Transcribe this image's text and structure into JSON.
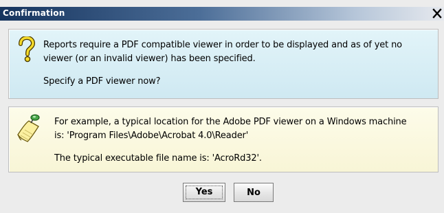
{
  "window": {
    "title": "Confirmation",
    "close_icon": "close-x-icon"
  },
  "info_panel": {
    "icon": "question-mark-icon",
    "line1": "Reports require a PDF compatible viewer in order to be displayed and as of yet no",
    "line2": "viewer (or an invalid viewer) has been specified.",
    "line3": "Specify a PDF viewer now?",
    "background": "#d9eef5"
  },
  "tip_panel": {
    "icon": "note-pushpin-icon",
    "line1": "For example, a typical location for the Adobe PDF viewer on a Windows machine",
    "line2": "is: 'Program Files\\Adobe\\Acrobat 4.0\\Reader'",
    "line3": "The typical executable file name is: 'AcroRd32'.",
    "background": "#fbf9e2"
  },
  "buttons": {
    "yes_label": "Yes",
    "no_label": "No"
  },
  "colors": {
    "title_bar_dark": "#16345e",
    "title_bar_light": "#e6e9ee",
    "dialog_bg": "#ececec"
  }
}
